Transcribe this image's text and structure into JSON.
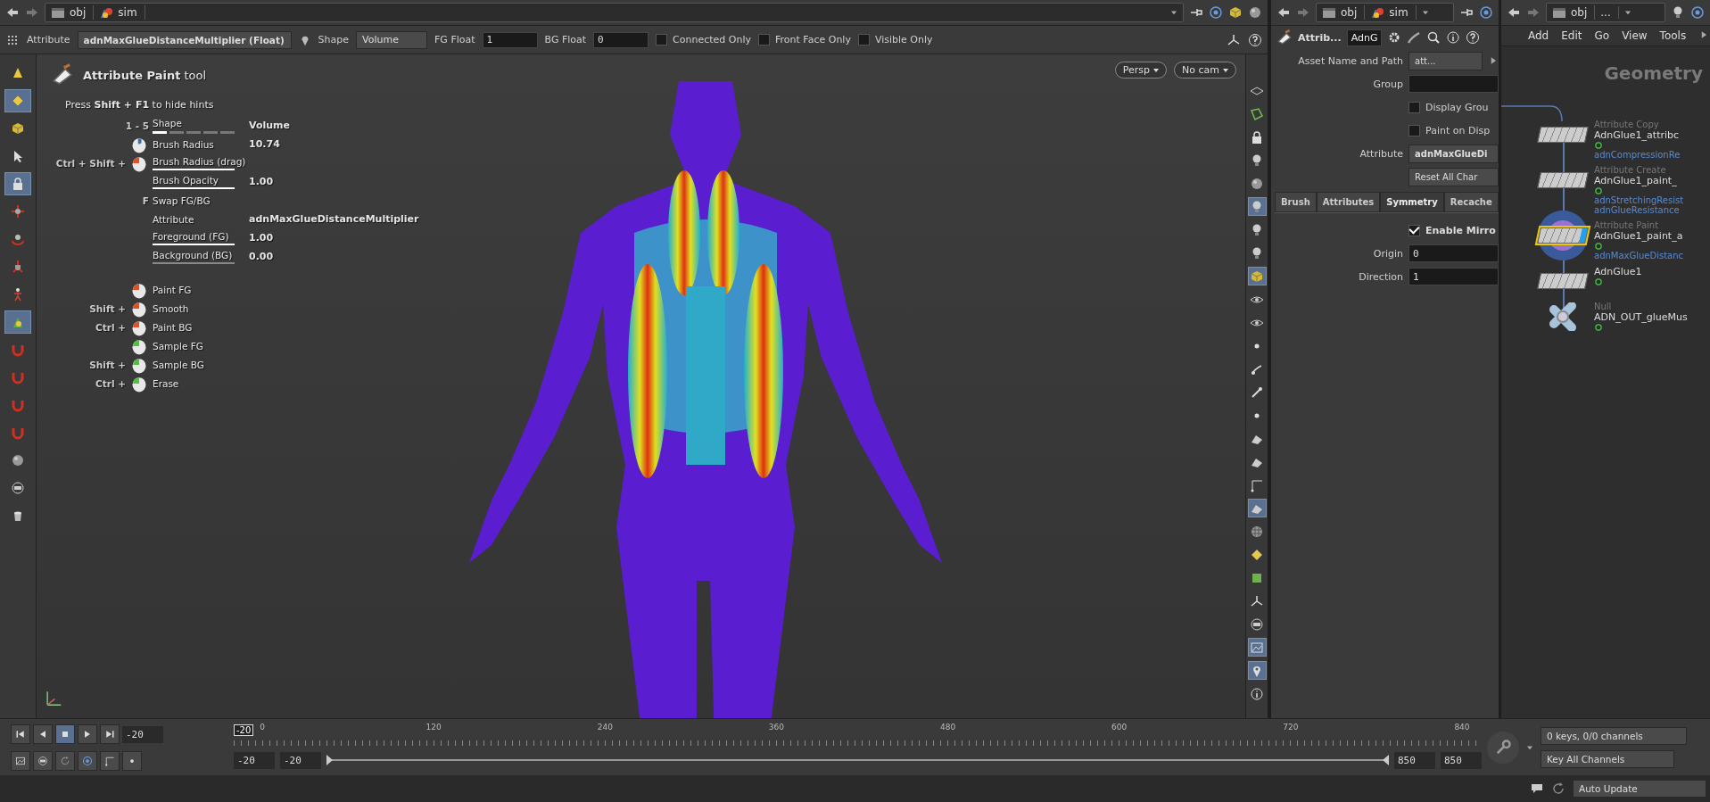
{
  "path_bar": {
    "crumbs": [
      {
        "kind": "clapper",
        "label": "obj"
      },
      {
        "kind": "shapes",
        "label": "sim"
      }
    ]
  },
  "tool_options": {
    "attribute": {
      "label": "Attribute",
      "value": "adnMaxGlueDistanceMultiplier (Float)"
    },
    "shape": {
      "label": "Shape",
      "value": "Volume"
    },
    "fg": {
      "label": "FG Float",
      "value": "1"
    },
    "bg": {
      "label": "BG Float",
      "value": "0"
    },
    "checkboxes": [
      {
        "label": "Connected Only",
        "checked": false
      },
      {
        "label": "Front Face Only",
        "checked": false
      },
      {
        "label": "Visible Only",
        "checked": false
      }
    ]
  },
  "left_toolbar": {
    "tools": [
      {
        "kind": "cone",
        "selected": false
      },
      {
        "kind": "diamond",
        "selected": true
      },
      {
        "kind": "cube",
        "selected": false
      },
      {
        "kind": "pointer",
        "selected": false
      },
      {
        "kind": "lock",
        "selected": true
      },
      {
        "kind": "move",
        "selected": false
      },
      {
        "kind": "rotate",
        "selected": false
      },
      {
        "kind": "scale",
        "selected": false
      },
      {
        "kind": "skeleton",
        "selected": false
      },
      {
        "kind": "pyramid",
        "selected": true
      },
      {
        "kind": "magnet",
        "selected": false
      },
      {
        "kind": "magnet",
        "selected": false
      },
      {
        "kind": "magnet",
        "selected": false
      },
      {
        "kind": "magnet",
        "selected": false
      },
      {
        "kind": "sphere",
        "selected": false
      },
      {
        "kind": "disc",
        "selected": false
      },
      {
        "kind": "bucket",
        "selected": false
      }
    ]
  },
  "hints": {
    "title": "**Attribute Paint** tool",
    "subtitle": "Press **Shift + F1** to hide hints",
    "rows": [
      {
        "keys": "1 - 5",
        "label": "Shape",
        "value": "Volume",
        "kind": "segments",
        "level": 0.2
      },
      {
        "mouse": {
          "kind": "wheel"
        },
        "label": "Brush Radius",
        "value": "10.74"
      },
      {
        "keys": "Ctrl + Shift +",
        "mouse": {
          "kind": "left"
        },
        "label": "Brush Radius (drag)",
        "kind": "bar",
        "level": 1
      },
      {
        "label": "Brush Opacity",
        "value": "1.00",
        "kind": "bar",
        "level": 1
      },
      {
        "keys": "F",
        "label": "Swap FG/BG"
      },
      {
        "label": "Attribute",
        "value": "adnMaxGlueDistanceMultiplier"
      },
      {
        "label": "Foreground (FG)",
        "value": "1.00",
        "kind": "bar",
        "level": 1
      },
      {
        "label": "Background (BG)",
        "value": "0.00",
        "kind": "bar",
        "level": 0
      }
    ],
    "actions": [
      {
        "mouse": {
          "kind": "left"
        },
        "label": "Paint FG"
      },
      {
        "keys": "Shift +",
        "mouse": {
          "kind": "left"
        },
        "label": "Smooth"
      },
      {
        "keys": "Ctrl +",
        "mouse": {
          "kind": "left"
        },
        "label": "Paint BG"
      },
      {
        "mouse": {
          "kind": "sample"
        },
        "label": "Sample FG"
      },
      {
        "keys": "Shift +",
        "mouse": {
          "kind": "sample"
        },
        "label": "Sample BG"
      },
      {
        "keys": "Ctrl +",
        "mouse": {
          "kind": "sample"
        },
        "label": "Erase"
      }
    ]
  },
  "viewport": {
    "menus": [
      "Persp",
      "No cam"
    ]
  },
  "viewport_toolbar": {
    "tools": [
      {
        "kind": "wireframe",
        "selected": false
      },
      {
        "kind": "uv",
        "selected": false
      },
      {
        "kind": "lock",
        "selected": false
      },
      {
        "kind": "bulb",
        "selected": false
      },
      {
        "kind": "sphere",
        "selected": false
      },
      {
        "kind": "bulb",
        "selected": true
      },
      {
        "kind": "bulb",
        "selected": false
      },
      {
        "kind": "bulb",
        "selected": false
      },
      {
        "kind": "cube",
        "selected": true
      },
      {
        "kind": "eye",
        "selected": false
      },
      {
        "kind": "eye",
        "selected": false
      },
      {
        "kind": "dot",
        "selected": false
      },
      {
        "kind": "curve",
        "selected": false
      },
      {
        "kind": "needle",
        "selected": false
      },
      {
        "kind": "dot",
        "selected": false
      },
      {
        "kind": "plane",
        "selected": false
      },
      {
        "kind": "plane",
        "selected": false
      },
      {
        "kind": "corner",
        "selected": false
      },
      {
        "kind": "plane",
        "selected": true
      },
      {
        "kind": "checker",
        "selected": false
      },
      {
        "kind": "diamond",
        "selected": false
      },
      {
        "kind": "square",
        "selected": false
      },
      {
        "kind": "branch",
        "selected": false
      },
      {
        "kind": "disc",
        "selected": false
      },
      {
        "kind": "image",
        "selected": true
      },
      {
        "kind": "pin",
        "selected": true
      },
      {
        "kind": "info",
        "selected": false
      }
    ]
  },
  "parameters": {
    "path": [
      {
        "kind": "clapper",
        "label": "obj"
      },
      {
        "kind": "shapes",
        "label": "sim"
      }
    ],
    "node_type": "Attrib...",
    "node_name": "AdnG",
    "asset": {
      "label": "Asset Name and Path",
      "value": "att..."
    },
    "group": {
      "label": "Group"
    },
    "toggles": [
      {
        "label": "Display Grou",
        "checked": false
      },
      {
        "label": "Paint on Disp",
        "checked": false
      }
    ],
    "attribute": {
      "label": "Attribute",
      "value": "adnMaxGlueDi"
    },
    "reset_button": "Reset All Char",
    "tabs": [
      {
        "label": "Brush",
        "selected": false
      },
      {
        "label": "Attributes",
        "selected": false
      },
      {
        "label": "Symmetry",
        "selected": true
      },
      {
        "label": "Recache",
        "selected": false
      }
    ],
    "mirror": {
      "label": "Enable Mirro",
      "checked": true
    },
    "fields": [
      {
        "label": "Origin",
        "value": "0"
      },
      {
        "label": "Direction",
        "value": "1"
      }
    ]
  },
  "network": {
    "path": [
      {
        "kind": "clapper",
        "label": "obj"
      },
      {
        "kind": "more",
        "label": "..."
      }
    ],
    "menu": [
      "Add",
      "Edit",
      "Go",
      "View",
      "Tools"
    ],
    "context_label": "Geometry",
    "nodes": [
      {
        "kind": "sop",
        "type": "Attribute Copy",
        "name": "AdnGlue1_attribc",
        "selected": false,
        "display": false,
        "flags": [
          "adnCompressionRe"
        ]
      },
      {
        "kind": "sop",
        "type": "Attribute Create",
        "name": "AdnGlue1_paint_",
        "selected": false,
        "display": false,
        "flags": [
          "adnStretchingResist",
          "adnGlueResistance"
        ]
      },
      {
        "kind": "sop",
        "type": "Attribute Paint",
        "name": "AdnGlue1_paint_a",
        "selected": true,
        "display": true,
        "flags": [
          "adnMaxGlueDistanc"
        ]
      },
      {
        "kind": "sop",
        "name": "AdnGlue1",
        "selected": false,
        "display": false
      },
      {
        "kind": "null",
        "type": "Null",
        "name": "ADN_OUT_glueMus",
        "selected": false,
        "display": false
      }
    ]
  },
  "timeline": {
    "transport": [
      {
        "kind": "first",
        "selected": false
      },
      {
        "kind": "prev",
        "selected": false
      },
      {
        "kind": "stop",
        "selected": true
      },
      {
        "kind": "play",
        "selected": false
      },
      {
        "kind": "last",
        "selected": false
      }
    ],
    "frame": "-20",
    "current": "-20",
    "ticks": [
      "0",
      "120",
      "240",
      "360",
      "480",
      "600",
      "720",
      "840"
    ],
    "range": [
      "-20",
      "-20",
      "850",
      "850"
    ],
    "range_slider": {
      "level": 1
    },
    "keys_info": "0 keys, 0/0 channels",
    "key_mode": "Key All Channels"
  },
  "status": {
    "update_mode": "Auto Update"
  }
}
